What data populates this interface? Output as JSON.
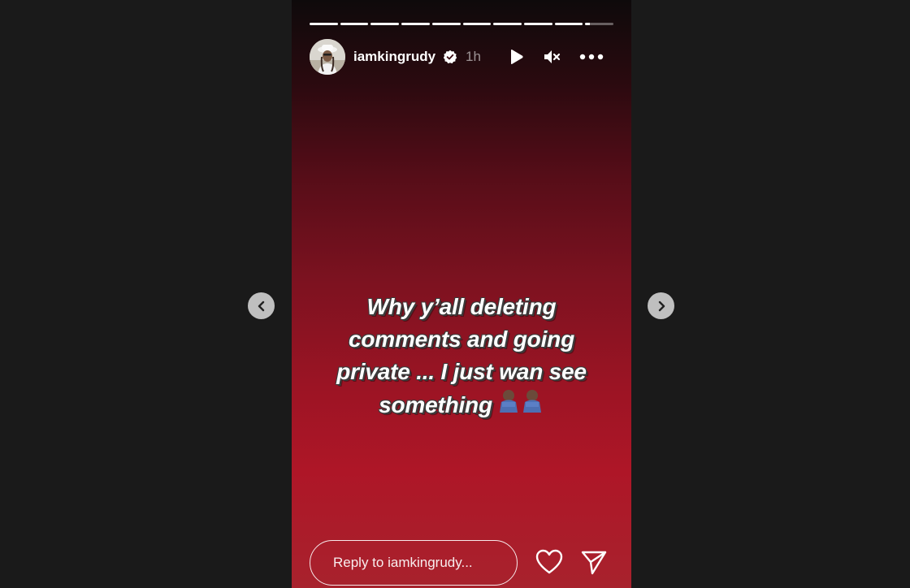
{
  "story": {
    "progress_segments": [
      1,
      1,
      1,
      1,
      1,
      1,
      1,
      1,
      1,
      0.15
    ],
    "user": {
      "username": "iamkingrudy",
      "verified": true,
      "time_ago": "1h",
      "avatar_icon": "avatar"
    },
    "controls": {
      "play_icon": "play-icon",
      "mute_icon": "muted-speaker-icon",
      "more_icon": "more-options-icon"
    },
    "caption": {
      "text": "Why y’all deleting comments and going private ... I just wan see something"
    },
    "footer": {
      "reply_placeholder": "Reply to iamkingrudy...",
      "like_icon": "heart-icon",
      "share_icon": "send-icon"
    }
  },
  "navigation": {
    "prev_icon": "chevron-left-icon",
    "next_icon": "chevron-right-icon"
  },
  "colors": {
    "page_background": "#1a1a1a",
    "story_gradient_top": "#0e0a0b",
    "story_gradient_bottom": "#ae1627",
    "nav_button": "#bfbfbf"
  }
}
